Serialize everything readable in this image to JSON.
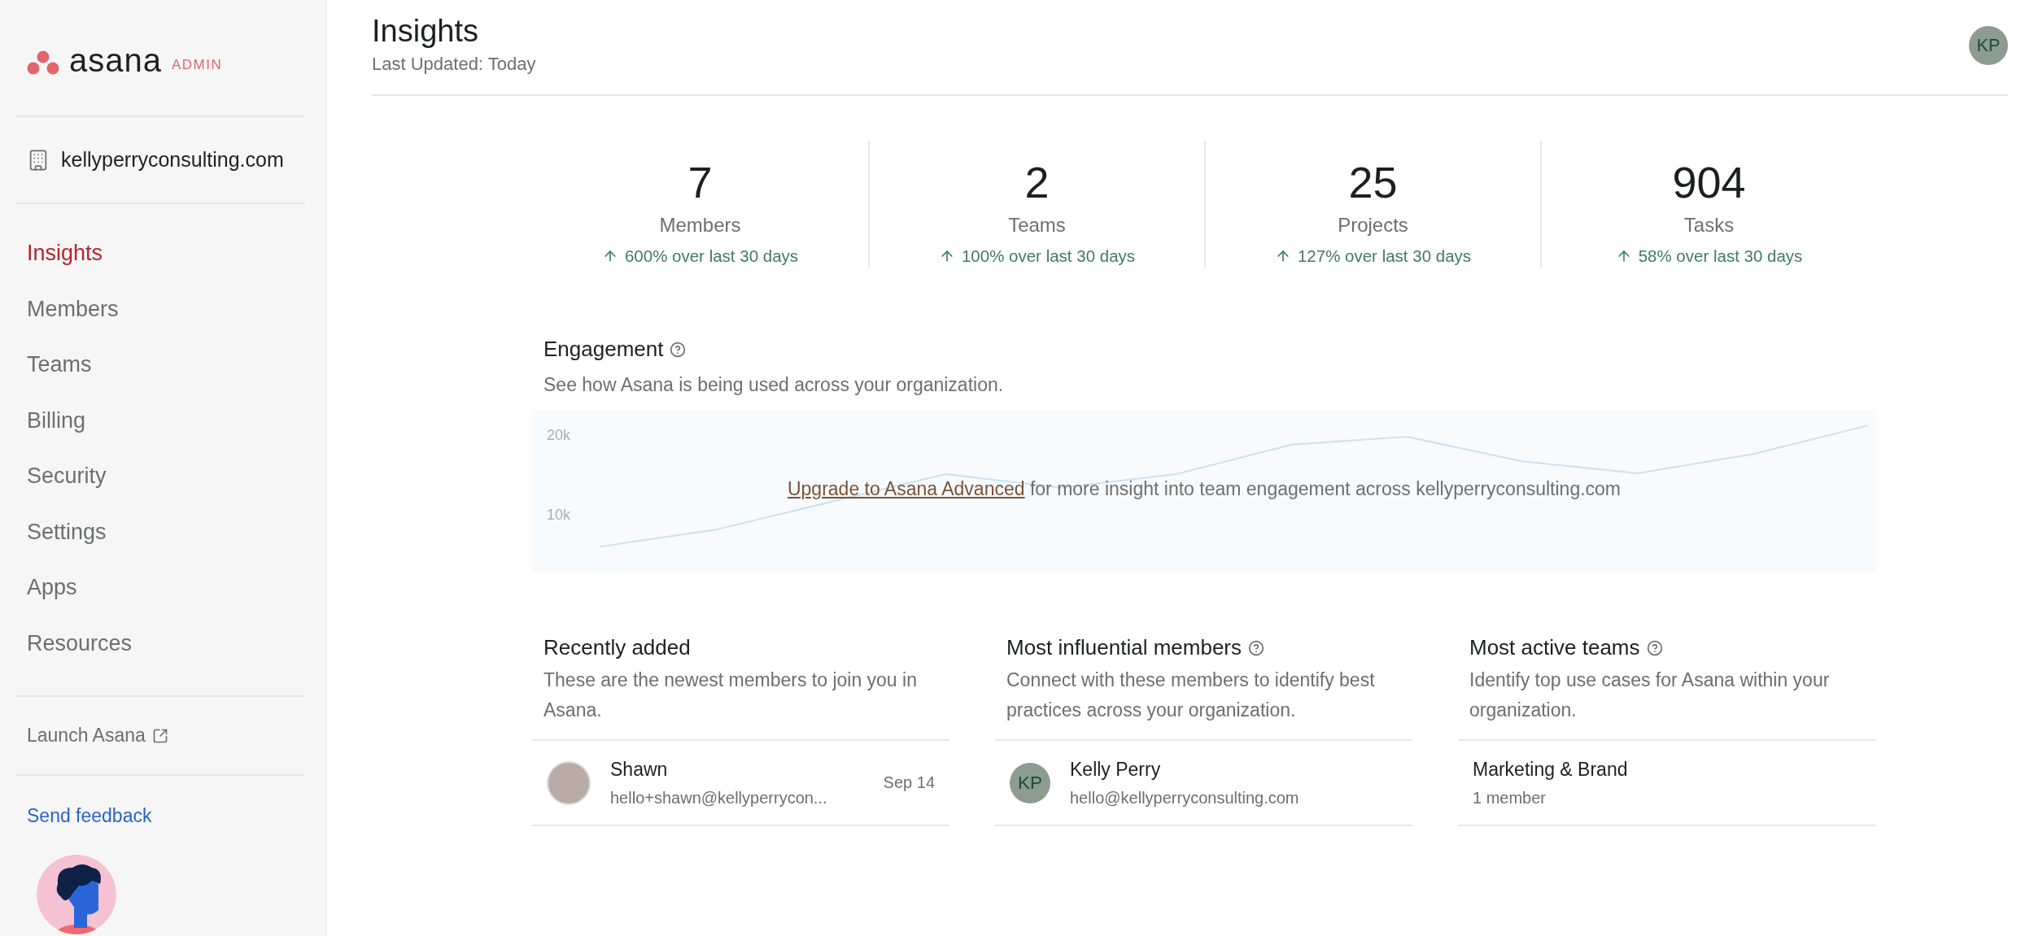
{
  "sidebar": {
    "logo_text": "asana",
    "logo_badge": "ADMIN",
    "organization": "kellyperryconsulting.com",
    "nav_items": [
      {
        "label": "Insights",
        "selected": true
      },
      {
        "label": "Members",
        "selected": false
      },
      {
        "label": "Teams",
        "selected": false
      },
      {
        "label": "Billing",
        "selected": false
      },
      {
        "label": "Security",
        "selected": false
      },
      {
        "label": "Settings",
        "selected": false
      },
      {
        "label": "Apps",
        "selected": false
      },
      {
        "label": "Resources",
        "selected": false
      }
    ],
    "launch_link": "Launch Asana",
    "feedback_link": "Send feedback"
  },
  "header": {
    "title": "Insights",
    "subtitle": "Last Updated: Today",
    "avatar_initials": "KP"
  },
  "stats": [
    {
      "value": "7",
      "label": "Members",
      "change": "600% over last 30 days"
    },
    {
      "value": "2",
      "label": "Teams",
      "change": "100% over last 30 days"
    },
    {
      "value": "25",
      "label": "Projects",
      "change": "127% over last 30 days"
    },
    {
      "value": "904",
      "label": "Tasks",
      "change": "58% over last 30 days"
    }
  ],
  "engagement": {
    "title": "Engagement",
    "description": "See how Asana is being used across your organization.",
    "upgrade_link": "Upgrade to Asana Advanced",
    "upgrade_text": "for more insight into team engagement across kellyperryconsulting.com",
    "chart_axis_labels": [
      "20k",
      "10k"
    ]
  },
  "panels": [
    {
      "title": "Recently added",
      "help": false,
      "description": "These are the newest members to join you in Asana.",
      "rows": [
        {
          "kind": "photo",
          "name": "Shawn",
          "detail": "hello+shawn@kellyperrycon...",
          "date": "Sep 14"
        }
      ]
    },
    {
      "title": "Most influential members",
      "help": true,
      "description": "Connect with these members to identify best practices across your organization.",
      "rows": [
        {
          "kind": "initials",
          "initials": "KP",
          "name": "Kelly Perry",
          "detail": "hello@kellyperryconsulting.com"
        }
      ]
    },
    {
      "title": "Most active teams",
      "help": true,
      "description": "Identify top use cases for Asana within your organization.",
      "rows": [
        {
          "kind": "team",
          "name": "Marketing & Brand",
          "detail": "1 member"
        }
      ]
    }
  ]
}
